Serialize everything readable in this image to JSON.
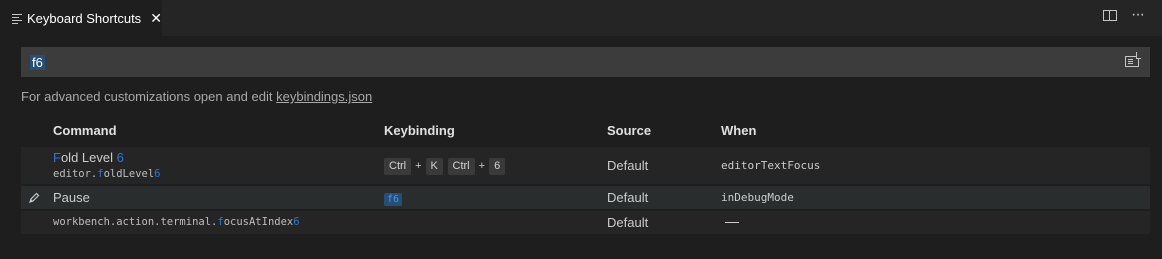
{
  "tab": {
    "title": "Keyboard Shortcuts",
    "close": "✕"
  },
  "actions": {
    "more": "···"
  },
  "search": {
    "value": "f6"
  },
  "hint": {
    "prefix": "For advanced customizations open and edit ",
    "link": "keybindings.json"
  },
  "columns": {
    "command": "Command",
    "keybinding": "Keybinding",
    "source": "Source",
    "when": "When"
  },
  "rows": [
    {
      "command_hl": "F",
      "command_rest": "old Level ",
      "command_num": "6",
      "id_prefix": "editor.",
      "id_hl": "f",
      "id_rest": "oldLevel",
      "id_num": "6",
      "keys": [
        "Ctrl",
        "K",
        "Ctrl",
        "6"
      ],
      "plus": "+",
      "source": "Default",
      "when": "editorTextFocus"
    },
    {
      "command": "Pause",
      "key": "f6",
      "source": "Default",
      "when": "inDebugMode"
    },
    {
      "id_prefix": "workbench.action.terminal.",
      "id_hl": "f",
      "id_rest": "ocusAtIndex",
      "id_num": "6",
      "source": "Default"
    }
  ],
  "colors": {
    "background": "#1e1e1e",
    "highlight": "#264f78",
    "match": "#2c78cf"
  }
}
